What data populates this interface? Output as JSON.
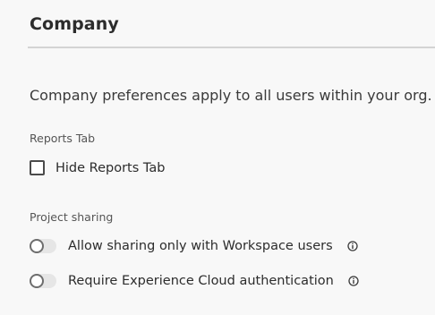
{
  "header": {
    "title": "Company"
  },
  "description": "Company preferences apply to all users within your org.",
  "reports_tab": {
    "section_label": "Reports Tab",
    "checkbox_label": "Hide Reports Tab",
    "checked": false
  },
  "project_sharing": {
    "section_label": "Project sharing",
    "toggles": [
      {
        "label": "Allow sharing only with Workspace users",
        "enabled": false,
        "icon": "info-icon"
      },
      {
        "label": "Require Experience Cloud authentication",
        "enabled": false,
        "icon": "info-icon"
      }
    ]
  },
  "colors": {
    "background": "#f8f8f8",
    "text": "#2c2c2c",
    "divider": "#d4d4d4"
  }
}
